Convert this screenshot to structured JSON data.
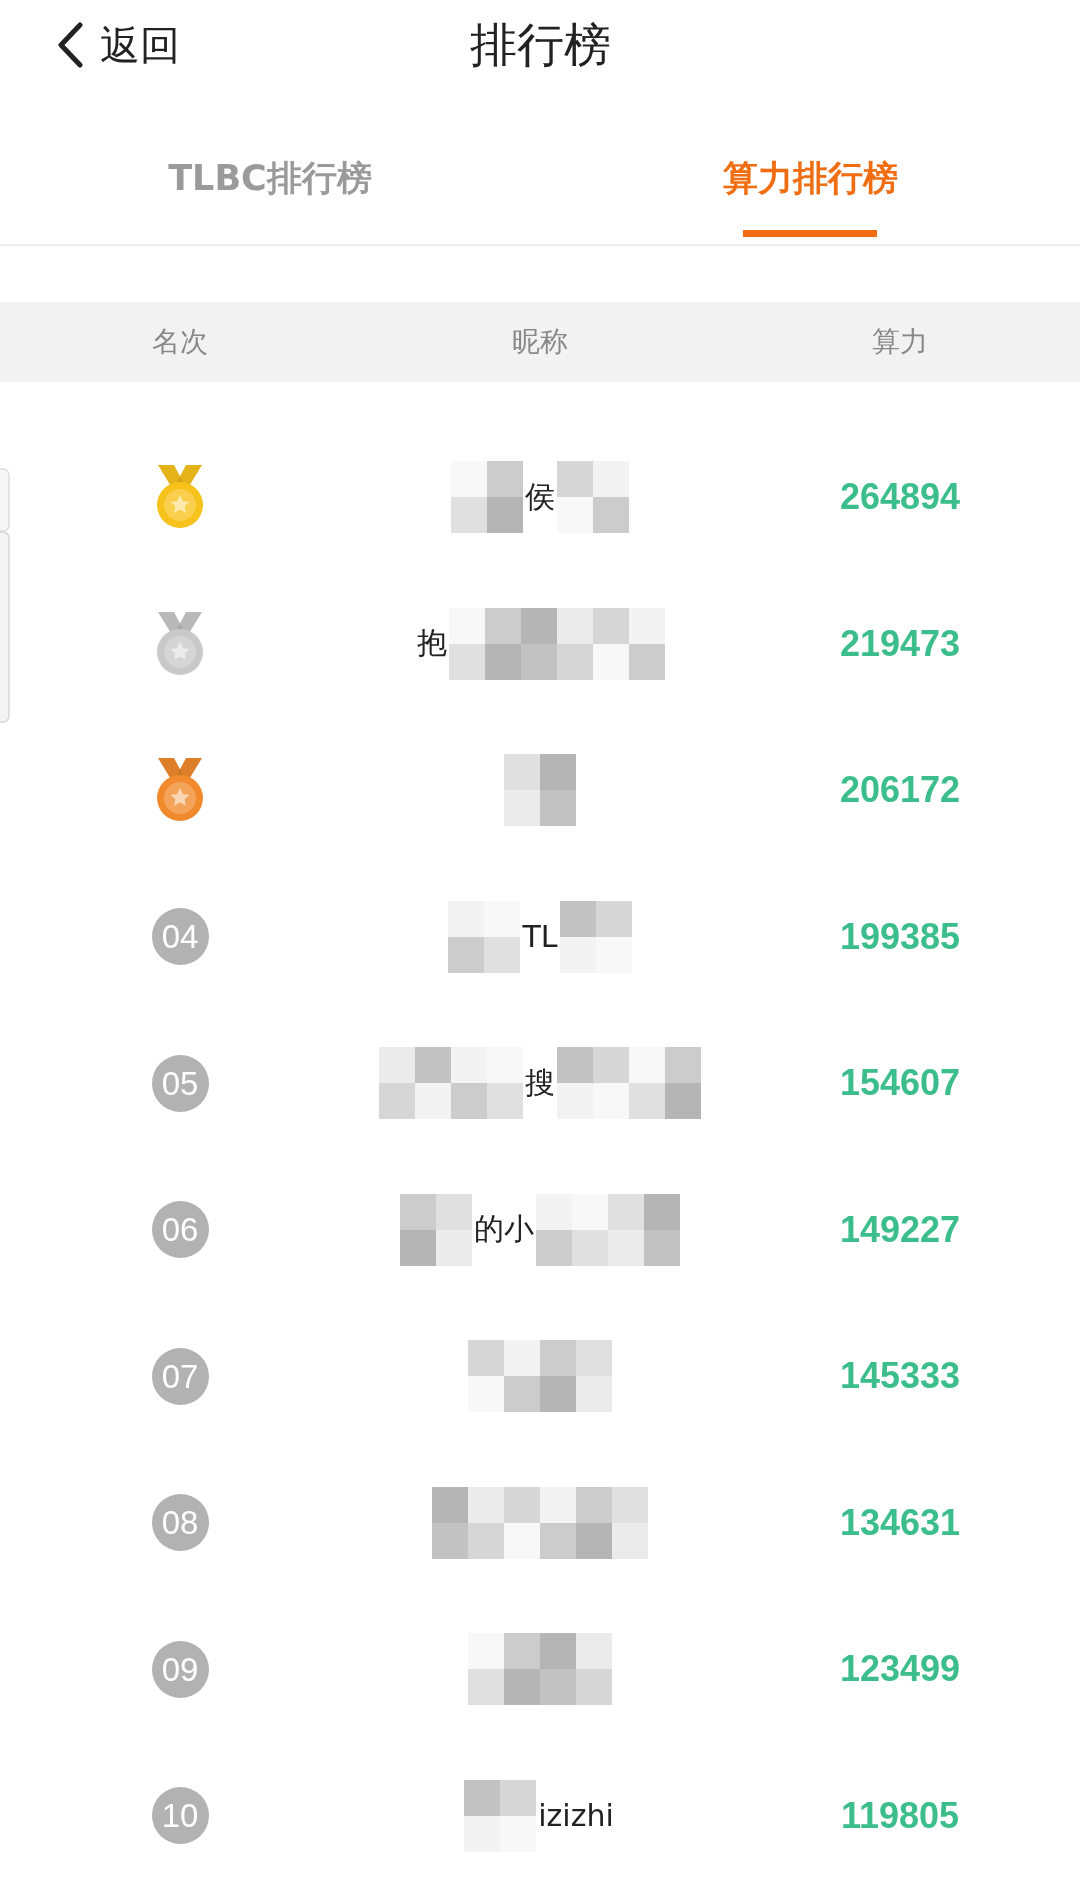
{
  "header": {
    "back_label": "返回",
    "title": "排行榜"
  },
  "tabs": [
    {
      "label": "TLBC排行榜",
      "selected": false
    },
    {
      "label": "算力排行榜",
      "selected": true
    }
  ],
  "table": {
    "columns": [
      "名次",
      "昵称",
      "算力"
    ],
    "rows": [
      {
        "kind": "medal",
        "color": "#f8c21c",
        "nickname": [
          {
            "kind": "mosaic"
          },
          {
            "kind": "text",
            "text": "侯"
          },
          {
            "kind": "mosaic"
          }
        ],
        "score": "264894"
      },
      {
        "kind": "medal",
        "color": "#c9c9c9",
        "nickname": [
          {
            "kind": "text",
            "text": "抱"
          },
          {
            "kind": "mosaic"
          },
          {
            "kind": "mosaic"
          },
          {
            "kind": "mosaic"
          }
        ],
        "score": "219473"
      },
      {
        "kind": "medal",
        "color": "#f08a2c",
        "nickname": [
          {
            "kind": "mosaic"
          }
        ],
        "score": "206172"
      },
      {
        "kind": "badge",
        "rank": "04",
        "nickname": [
          {
            "kind": "mosaic"
          },
          {
            "kind": "text",
            "text": "TL"
          },
          {
            "kind": "mosaic"
          }
        ],
        "score": "199385"
      },
      {
        "kind": "badge",
        "rank": "05",
        "nickname": [
          {
            "kind": "mosaic"
          },
          {
            "kind": "mosaic"
          },
          {
            "kind": "text",
            "text": "搜"
          },
          {
            "kind": "mosaic"
          },
          {
            "kind": "mosaic"
          }
        ],
        "score": "154607"
      },
      {
        "kind": "badge",
        "rank": "06",
        "nickname": [
          {
            "kind": "mosaic"
          },
          {
            "kind": "text",
            "text": "的小"
          },
          {
            "kind": "mosaic"
          },
          {
            "kind": "mosaic"
          }
        ],
        "score": "149227"
      },
      {
        "kind": "badge",
        "rank": "07",
        "nickname": [
          {
            "kind": "mosaic"
          },
          {
            "kind": "mosaic"
          }
        ],
        "score": "145333"
      },
      {
        "kind": "badge",
        "rank": "08",
        "nickname": [
          {
            "kind": "mosaic"
          },
          {
            "kind": "mosaic"
          },
          {
            "kind": "mosaic"
          }
        ],
        "score": "134631"
      },
      {
        "kind": "badge",
        "rank": "09",
        "nickname": [
          {
            "kind": "mosaic"
          },
          {
            "kind": "mosaic"
          }
        ],
        "score": "123499"
      },
      {
        "kind": "badge",
        "rank": "10",
        "nickname": [
          {
            "kind": "mosaic"
          },
          {
            "kind": "text",
            "text": "izizhi"
          }
        ],
        "score": "119805"
      }
    ]
  }
}
